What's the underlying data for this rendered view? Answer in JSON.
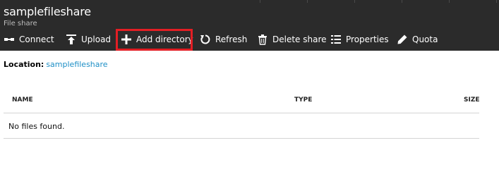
{
  "header": {
    "title": "samplefileshare",
    "subtitle": "File share"
  },
  "toolbar": {
    "connect_label": "Connect",
    "upload_label": "Upload",
    "add_directory_label": "Add directory",
    "refresh_label": "Refresh",
    "delete_share_label": "Delete share",
    "properties_label": "Properties",
    "quota_label": "Quota"
  },
  "location": {
    "label": "Location:",
    "value": "samplefileshare"
  },
  "table": {
    "columns": [
      "NAME",
      "TYPE",
      "SIZE"
    ],
    "empty_message": "No files found."
  },
  "colors": {
    "header_bg": "#2b2b2b",
    "link": "#1e8fc6",
    "highlight": "#e31e24"
  },
  "icons": [
    "connect-icon",
    "upload-icon",
    "plus-icon",
    "refresh-icon",
    "trash-icon",
    "list-icon",
    "pencil-icon"
  ]
}
